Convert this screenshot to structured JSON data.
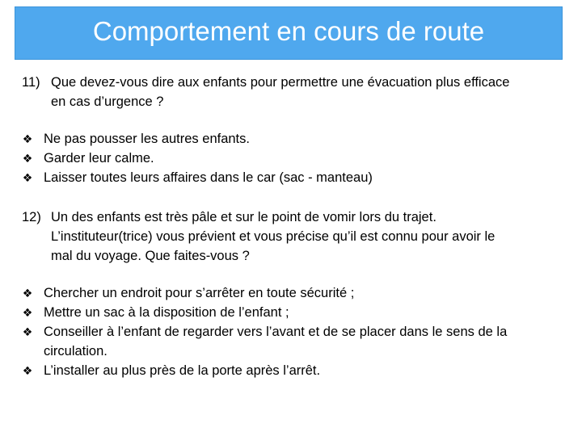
{
  "slide": {
    "title": "Comportement en cours de route",
    "bullet_glyph": "❖",
    "q11": {
      "number": "11)",
      "line1": "Que devez-vous dire aux enfants pour permettre une évacuation plus efficace",
      "line2": "en cas d’urgence ?"
    },
    "answers11": [
      "Ne pas pousser les autres enfants.",
      "Garder leur calme.",
      "Laisser toutes leurs affaires dans le car (sac - manteau)"
    ],
    "q12": {
      "number": "12)",
      "line1": "Un des enfants est très pâle et sur le point de vomir lors du trajet.",
      "line2": "L’instituteur(trice) vous prévient et vous précise qu’il est connu pour avoir le",
      "line3": "mal du voyage. Que faites-vous ?"
    },
    "answers12": [
      "Chercher un endroit pour s’arrêter en toute sécurité ;",
      "Mettre un sac à la disposition de l’enfant ;",
      "Conseiller à l’enfant de regarder vers l’avant et de se placer dans le sens de la",
      "circulation.",
      "L’installer au plus près de la porte après l’arrêt."
    ],
    "colors": {
      "title_bar": "#4fa8ee",
      "title_text": "#ffffff",
      "body_text": "#000000"
    }
  }
}
